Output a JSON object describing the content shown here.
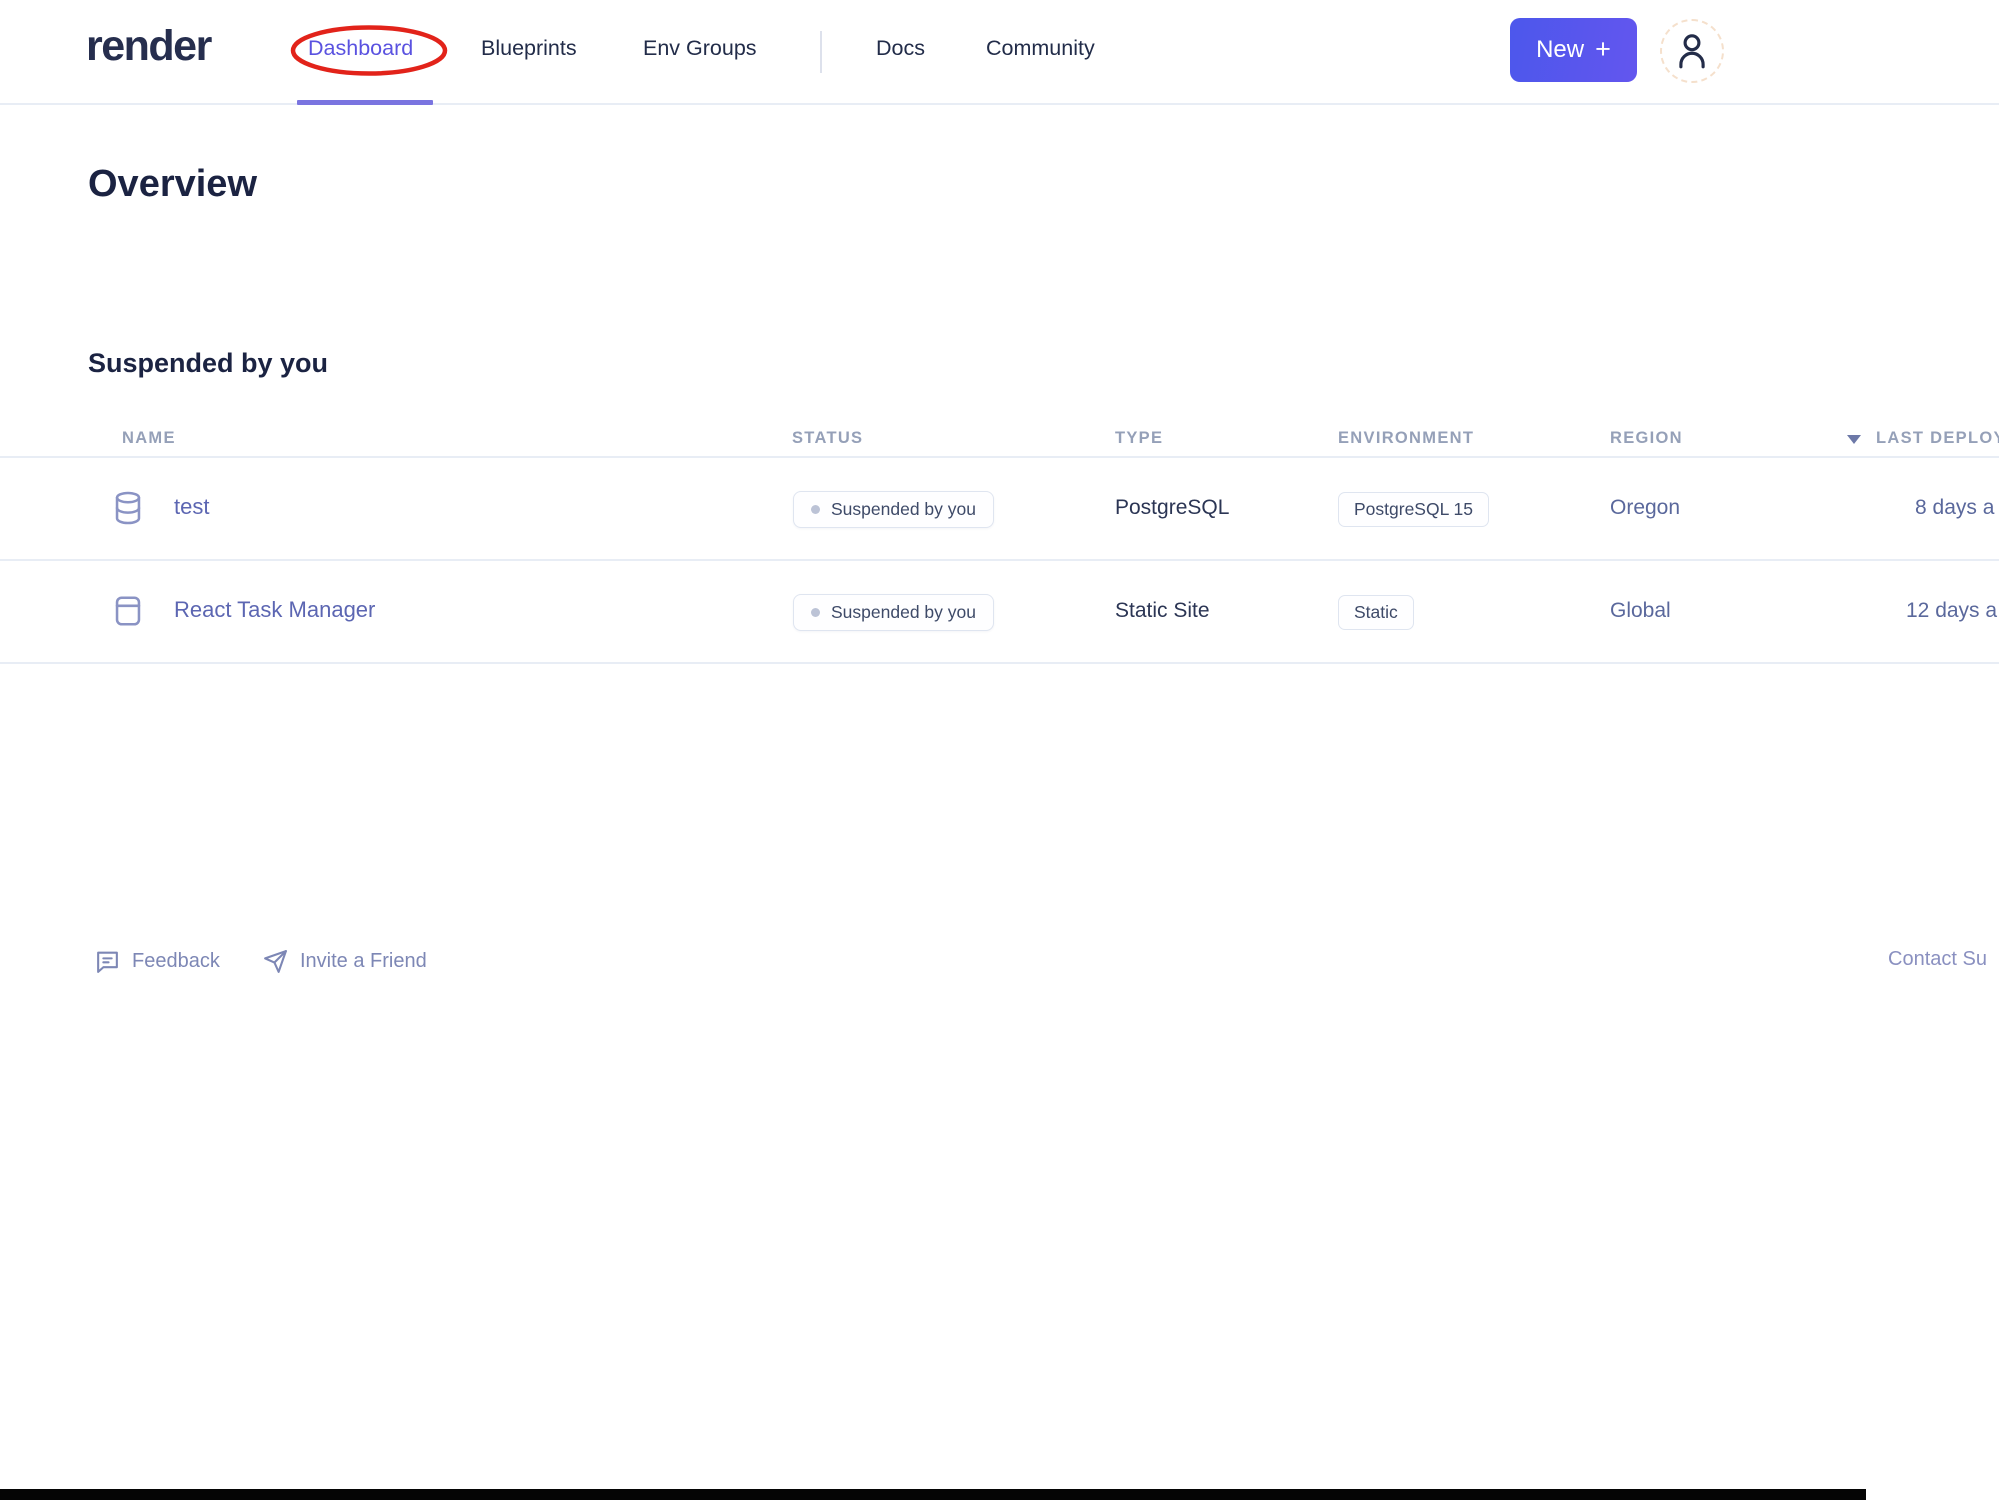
{
  "header": {
    "logo": "render",
    "nav": [
      {
        "label": "Dashboard"
      },
      {
        "label": "Blueprints"
      },
      {
        "label": "Env Groups"
      },
      {
        "label": "Docs"
      },
      {
        "label": "Community"
      }
    ],
    "new_button": {
      "label": "New",
      "plus": "+"
    }
  },
  "page_title": "Overview",
  "section_title": "Suspended by you",
  "table": {
    "columns": {
      "name": "NAME",
      "status": "STATUS",
      "type": "TYPE",
      "environment": "ENVIRONMENT",
      "region": "REGION",
      "last_deploy": "LAST DEPLOY"
    },
    "rows": [
      {
        "name": "test",
        "icon": "database-icon",
        "status": "Suspended by you",
        "type": "PostgreSQL",
        "environment": "PostgreSQL 15",
        "region": "Oregon",
        "last_deploy": "8 days a"
      },
      {
        "name": "React Task Manager",
        "icon": "static-site-icon",
        "status": "Suspended by you",
        "type": "Static Site",
        "environment": "Static",
        "region": "Global",
        "last_deploy": "12 days a"
      }
    ]
  },
  "footer": {
    "feedback": "Feedback",
    "invite": "Invite a Friend",
    "contact": "Contact Su"
  },
  "colors": {
    "accent-start": "#4c57ec",
    "accent-end": "#6356ee",
    "nav-active": "#5a52e0",
    "underline": "#7a74e0",
    "annotation": "#e2231a",
    "ink": "#222c49",
    "logo-ink": "#262e4e",
    "heading-ink": "#1b2342",
    "muted-header": "#95a0b8",
    "link": "#5c66b2",
    "type-ink": "#2b3554",
    "region-ink": "#5a689c",
    "badge-border": "#dfe5f0",
    "badge-ink": "#3e4a68",
    "dot": "#bcc3d6",
    "line": "#e8edf5",
    "footer-ink": "#7d87b5",
    "contact-ink": "#8a90c0",
    "icon": "#8a93c4"
  }
}
